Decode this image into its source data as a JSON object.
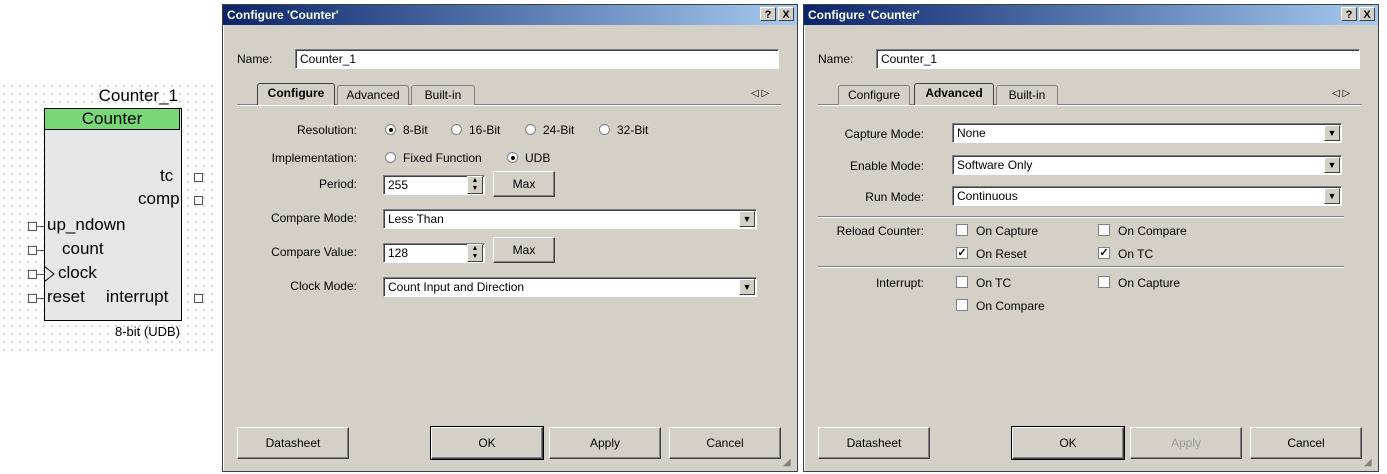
{
  "symbol": {
    "instance": "Counter_1",
    "component": "Counter",
    "pins_right": [
      "tc",
      "comp",
      "interrupt"
    ],
    "pins_left": [
      "up_ndown",
      "count",
      "clock",
      "reset"
    ],
    "footer": "8-bit (UDB)",
    "header_color": "#78d878"
  },
  "dialog1": {
    "title": "Configure 'Counter'",
    "help": "?",
    "close": "X",
    "name_label": "Name:",
    "name_value": "Counter_1",
    "tabs": [
      "Configure",
      "Advanced",
      "Built-in"
    ],
    "active_tab": "Configure",
    "scroll_arrows": "◁ ▷",
    "resolution_label": "Resolution:",
    "resolution_options": [
      "8-Bit",
      "16-Bit",
      "24-Bit",
      "32-Bit"
    ],
    "resolution_selected": "8-Bit",
    "implementation_label": "Implementation:",
    "implementation_options": [
      "Fixed Function",
      "UDB"
    ],
    "implementation_selected": "UDB",
    "period_label": "Period:",
    "period_value": "255",
    "max_label": "Max",
    "compare_mode_label": "Compare Mode:",
    "compare_mode_value": "Less Than",
    "compare_value_label": "Compare Value:",
    "compare_value": "128",
    "clock_mode_label": "Clock Mode:",
    "clock_mode_value": "Count Input and Direction",
    "buttons": {
      "datasheet": "Datasheet",
      "ok": "OK",
      "apply": "Apply",
      "cancel": "Cancel"
    }
  },
  "dialog2": {
    "title": "Configure 'Counter'",
    "help": "?",
    "close": "X",
    "name_label": "Name:",
    "name_value": "Counter_1",
    "tabs": [
      "Configure",
      "Advanced",
      "Built-in"
    ],
    "active_tab": "Advanced",
    "scroll_arrows": "◁ ▷",
    "capture_mode_label": "Capture Mode:",
    "capture_mode_value": "None",
    "enable_mode_label": "Enable Mode:",
    "enable_mode_value": "Software Only",
    "run_mode_label": "Run Mode:",
    "run_mode_value": "Continuous",
    "reload_label": "Reload Counter:",
    "reload_options": [
      {
        "label": "On Capture",
        "checked": false
      },
      {
        "label": "On Compare",
        "checked": false
      },
      {
        "label": "On Reset",
        "checked": true
      },
      {
        "label": "On TC",
        "checked": true
      }
    ],
    "interrupt_label": "Interrupt:",
    "interrupt_options": [
      {
        "label": "On TC",
        "checked": false
      },
      {
        "label": "On Capture",
        "checked": false
      },
      {
        "label": "On Compare",
        "checked": false
      }
    ],
    "buttons": {
      "datasheet": "Datasheet",
      "ok": "OK",
      "apply": "Apply",
      "cancel": "Cancel"
    }
  }
}
